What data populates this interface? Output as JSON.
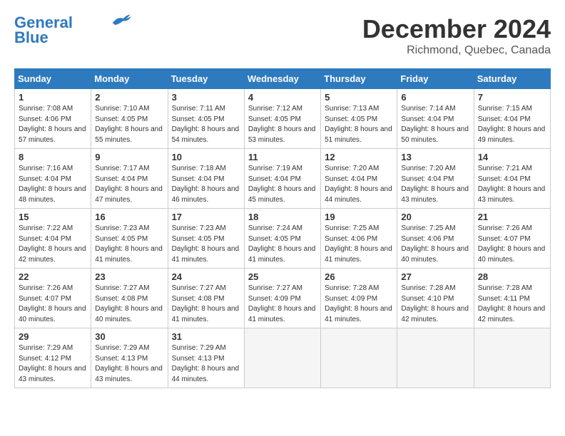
{
  "logo": {
    "line1": "General",
    "line2": "Blue"
  },
  "title": "December 2024",
  "location": "Richmond, Quebec, Canada",
  "days_of_week": [
    "Sunday",
    "Monday",
    "Tuesday",
    "Wednesday",
    "Thursday",
    "Friday",
    "Saturday"
  ],
  "weeks": [
    [
      {
        "day": 1,
        "sunrise": "7:08 AM",
        "sunset": "4:06 PM",
        "daylight": "8 hours and 57 minutes."
      },
      {
        "day": 2,
        "sunrise": "7:10 AM",
        "sunset": "4:05 PM",
        "daylight": "8 hours and 55 minutes."
      },
      {
        "day": 3,
        "sunrise": "7:11 AM",
        "sunset": "4:05 PM",
        "daylight": "8 hours and 54 minutes."
      },
      {
        "day": 4,
        "sunrise": "7:12 AM",
        "sunset": "4:05 PM",
        "daylight": "8 hours and 53 minutes."
      },
      {
        "day": 5,
        "sunrise": "7:13 AM",
        "sunset": "4:05 PM",
        "daylight": "8 hours and 51 minutes."
      },
      {
        "day": 6,
        "sunrise": "7:14 AM",
        "sunset": "4:04 PM",
        "daylight": "8 hours and 50 minutes."
      },
      {
        "day": 7,
        "sunrise": "7:15 AM",
        "sunset": "4:04 PM",
        "daylight": "8 hours and 49 minutes."
      }
    ],
    [
      {
        "day": 8,
        "sunrise": "7:16 AM",
        "sunset": "4:04 PM",
        "daylight": "8 hours and 48 minutes."
      },
      {
        "day": 9,
        "sunrise": "7:17 AM",
        "sunset": "4:04 PM",
        "daylight": "8 hours and 47 minutes."
      },
      {
        "day": 10,
        "sunrise": "7:18 AM",
        "sunset": "4:04 PM",
        "daylight": "8 hours and 46 minutes."
      },
      {
        "day": 11,
        "sunrise": "7:19 AM",
        "sunset": "4:04 PM",
        "daylight": "8 hours and 45 minutes."
      },
      {
        "day": 12,
        "sunrise": "7:20 AM",
        "sunset": "4:04 PM",
        "daylight": "8 hours and 44 minutes."
      },
      {
        "day": 13,
        "sunrise": "7:20 AM",
        "sunset": "4:04 PM",
        "daylight": "8 hours and 43 minutes."
      },
      {
        "day": 14,
        "sunrise": "7:21 AM",
        "sunset": "4:04 PM",
        "daylight": "8 hours and 43 minutes."
      }
    ],
    [
      {
        "day": 15,
        "sunrise": "7:22 AM",
        "sunset": "4:04 PM",
        "daylight": "8 hours and 42 minutes."
      },
      {
        "day": 16,
        "sunrise": "7:23 AM",
        "sunset": "4:05 PM",
        "daylight": "8 hours and 41 minutes."
      },
      {
        "day": 17,
        "sunrise": "7:23 AM",
        "sunset": "4:05 PM",
        "daylight": "8 hours and 41 minutes."
      },
      {
        "day": 18,
        "sunrise": "7:24 AM",
        "sunset": "4:05 PM",
        "daylight": "8 hours and 41 minutes."
      },
      {
        "day": 19,
        "sunrise": "7:25 AM",
        "sunset": "4:06 PM",
        "daylight": "8 hours and 41 minutes."
      },
      {
        "day": 20,
        "sunrise": "7:25 AM",
        "sunset": "4:06 PM",
        "daylight": "8 hours and 40 minutes."
      },
      {
        "day": 21,
        "sunrise": "7:26 AM",
        "sunset": "4:07 PM",
        "daylight": "8 hours and 40 minutes."
      }
    ],
    [
      {
        "day": 22,
        "sunrise": "7:26 AM",
        "sunset": "4:07 PM",
        "daylight": "8 hours and 40 minutes."
      },
      {
        "day": 23,
        "sunrise": "7:27 AM",
        "sunset": "4:08 PM",
        "daylight": "8 hours and 40 minutes."
      },
      {
        "day": 24,
        "sunrise": "7:27 AM",
        "sunset": "4:08 PM",
        "daylight": "8 hours and 41 minutes."
      },
      {
        "day": 25,
        "sunrise": "7:27 AM",
        "sunset": "4:09 PM",
        "daylight": "8 hours and 41 minutes."
      },
      {
        "day": 26,
        "sunrise": "7:28 AM",
        "sunset": "4:09 PM",
        "daylight": "8 hours and 41 minutes."
      },
      {
        "day": 27,
        "sunrise": "7:28 AM",
        "sunset": "4:10 PM",
        "daylight": "8 hours and 42 minutes."
      },
      {
        "day": 28,
        "sunrise": "7:28 AM",
        "sunset": "4:11 PM",
        "daylight": "8 hours and 42 minutes."
      }
    ],
    [
      {
        "day": 29,
        "sunrise": "7:29 AM",
        "sunset": "4:12 PM",
        "daylight": "8 hours and 43 minutes."
      },
      {
        "day": 30,
        "sunrise": "7:29 AM",
        "sunset": "4:13 PM",
        "daylight": "8 hours and 43 minutes."
      },
      {
        "day": 31,
        "sunrise": "7:29 AM",
        "sunset": "4:13 PM",
        "daylight": "8 hours and 44 minutes."
      },
      null,
      null,
      null,
      null
    ]
  ]
}
